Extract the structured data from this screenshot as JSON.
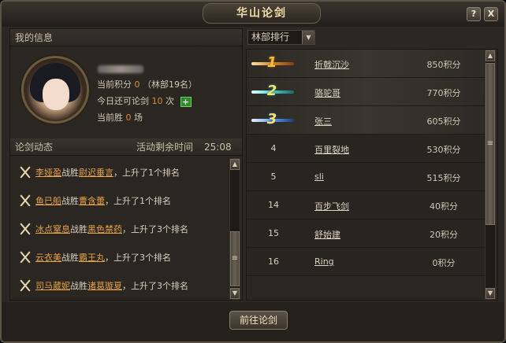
{
  "window": {
    "title": "华山论剑"
  },
  "title_buttons": {
    "help": "?",
    "close": "X"
  },
  "my_info": {
    "header": "我的信息",
    "points_label": "当前积分",
    "points_value": "0",
    "points_rank": "（林部19名）",
    "remaining_label": "今日还可论剑",
    "remaining_value": "10",
    "remaining_unit": "次",
    "wins_label": "当前胜",
    "wins_value": "0",
    "wins_unit": "场"
  },
  "news": {
    "header": "论剑动态",
    "time_label": "活动剩余时间",
    "time_value": "25:08",
    "items": [
      {
        "winner": "李娅盈",
        "verb": "战胜",
        "loser": "尉迟垂言",
        "result": "，上升了1个排名"
      },
      {
        "winner": "鱼已船",
        "verb": "战胜",
        "loser": "曹含蕾",
        "result": "，上升了1个排名"
      },
      {
        "winner": "冰点窒息",
        "verb": "战胜",
        "loser": "黑色禁药",
        "result": "，上升了3个排名"
      },
      {
        "winner": "云衣美",
        "verb": "战胜",
        "loser": "霸王丸",
        "result": "，上升了3个排名"
      },
      {
        "winner": "司马葳妮",
        "verb": "战胜",
        "loser": "诸葛璇夏",
        "result": "，上升了3个排名"
      }
    ]
  },
  "ranking": {
    "dropdown_label": "林部排行",
    "rows": [
      {
        "rank": "1",
        "name": "折戟沉沙",
        "score": "850积分",
        "medal": "gold"
      },
      {
        "rank": "2",
        "name": "骆驼哥",
        "score": "770积分",
        "medal": "silver"
      },
      {
        "rank": "3",
        "name": "张三",
        "score": "605积分",
        "medal": "bronze"
      },
      {
        "rank": "4",
        "name": "百里裂地",
        "score": "530积分"
      },
      {
        "rank": "5",
        "name": "sli",
        "score": "515积分"
      },
      {
        "rank": "14",
        "name": "百步飞剑",
        "score": "40积分"
      },
      {
        "rank": "15",
        "name": "舒始建",
        "score": "20积分"
      },
      {
        "rank": "16",
        "name": "Ring",
        "score": "0积分"
      }
    ]
  },
  "actions": {
    "go_button": "前往论剑"
  },
  "icons": {
    "plus": "+",
    "scroll_up": "▲",
    "scroll_down": "▼",
    "scroll_grip": "≡",
    "dropdown_arrow": "▼"
  },
  "colors": {
    "accent_orange": "#e08a36",
    "title_gold": "#f2dca6",
    "medal_gold": "#f0c040",
    "medal_silver": "#48d0d0",
    "medal_bronze": "#5ea0f0"
  }
}
